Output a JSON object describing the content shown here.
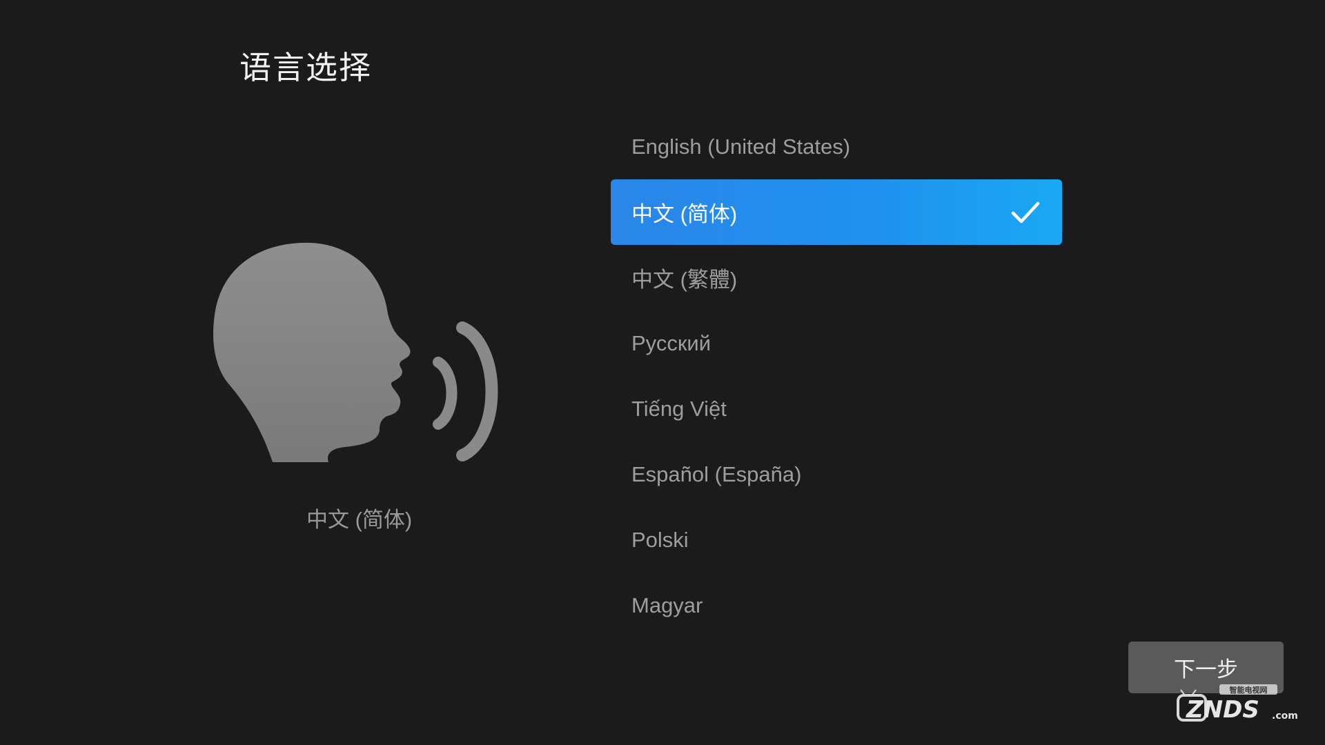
{
  "header": {
    "title": "语言选择"
  },
  "left_panel": {
    "illustration_icon": "speaking-head-icon",
    "current_language": "中文 (简体)"
  },
  "languages": [
    {
      "label": "English (United States)",
      "selected": false
    },
    {
      "label": "中文 (简体)",
      "selected": true
    },
    {
      "label": "中文 (繁體)",
      "selected": false
    },
    {
      "label": "Русский",
      "selected": false
    },
    {
      "label": "Tiếng Việt",
      "selected": false
    },
    {
      "label": "Español (España)",
      "selected": false
    },
    {
      "label": "Polski",
      "selected": false
    },
    {
      "label": "Magyar",
      "selected": false
    }
  ],
  "selection_icon": "checkmark-icon",
  "footer": {
    "next_label": "下一步"
  },
  "watermark": {
    "brand": "ZNDS",
    "suffix": ".com",
    "tagline": "智能电视网"
  },
  "colors": {
    "background": "#1b1b1b",
    "accent": "#2a86e8",
    "accent_end": "#1aa8f4",
    "button": "#5a5a5a",
    "text_muted": "#9e9e9e"
  }
}
